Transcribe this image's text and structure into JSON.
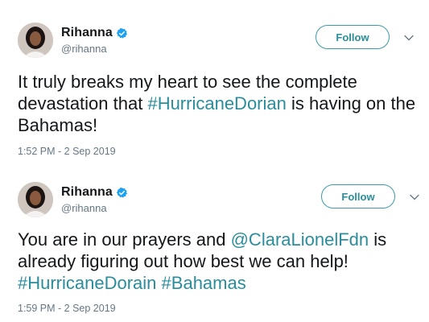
{
  "tweets": [
    {
      "name": "Rihanna",
      "handle": "@rihanna",
      "follow_label": "Follow",
      "text_parts": [
        {
          "type": "text",
          "value": "It truly breaks my heart to see the complete devastation that "
        },
        {
          "type": "link",
          "value": "#HurricaneDorian"
        },
        {
          "type": "text",
          "value": " is having on the Bahamas!"
        }
      ],
      "timestamp": "1:52 PM - 2 Sep 2019"
    },
    {
      "name": "Rihanna",
      "handle": "@rihanna",
      "follow_label": "Follow",
      "text_parts": [
        {
          "type": "text",
          "value": "You are in our prayers and "
        },
        {
          "type": "link",
          "value": "@ClaraLionelFdn"
        },
        {
          "type": "text",
          "value": " is already figuring out how best we can help! "
        },
        {
          "type": "link",
          "value": "#HurricaneDorain"
        },
        {
          "type": "text",
          "value": " "
        },
        {
          "type": "link",
          "value": "#Bahamas"
        }
      ],
      "timestamp": "1:59 PM - 2 Sep 2019"
    }
  ],
  "colors": {
    "link": "#2a8d9b",
    "verified": "#1da1f2",
    "secondary_text": "#657786"
  },
  "icons": {
    "verified": "verified-badge-icon",
    "caret": "chevron-down-icon",
    "avatar": "profile-photo"
  }
}
